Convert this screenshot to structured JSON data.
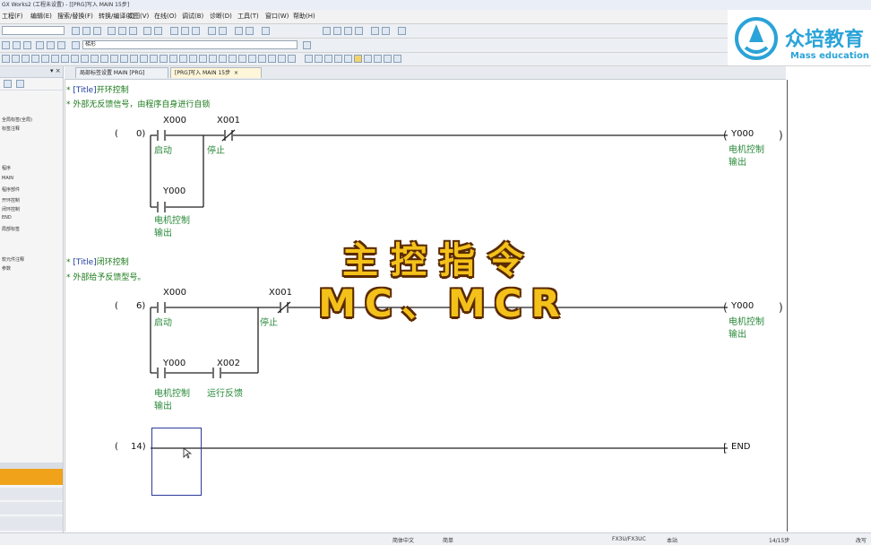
{
  "window": {
    "title": "GX Works2 (工程未设置) - [[PRG]写入 MAIN 15步]"
  },
  "menu": [
    "工程(F)",
    "编辑(E)",
    "搜索/替换(F)",
    "转换/编译(C)",
    "视图(V)",
    "在线(O)",
    "调试(B)",
    "诊断(D)",
    "工具(T)",
    "窗口(W)",
    "帮助(H)"
  ],
  "toolbar": {
    "combo1": "",
    "combo2": "梯形"
  },
  "tabs": [
    {
      "label": "局部标签设置 MAIN [PRG]",
      "active": false
    },
    {
      "label": "[PRG]写入 MAIN 15步",
      "active": true
    }
  ],
  "left_panel": {
    "items": [
      "全局标签(全局)",
      "标签注释",
      "程序",
      "MAIN",
      "程序部件",
      "开环控制",
      "闭环控制",
      "END",
      "局部标签",
      "软元件注释",
      "参数"
    ]
  },
  "ladder": {
    "comments": [
      {
        "tag": "[Title]",
        "text": "开环控制"
      },
      {
        "text": "外部无反馈信号，由程序自身进行自锁"
      },
      {
        "tag": "[Title]",
        "text": "闭环控制"
      },
      {
        "text": "外部给予反馈型号。"
      }
    ],
    "rungs": [
      {
        "step": "0)",
        "contacts": [
          {
            "device": "X000",
            "label": "启动"
          },
          {
            "device": "X001",
            "label": "停止"
          },
          {
            "device": "Y000",
            "label1": "电机控制",
            "label2": "输出"
          }
        ],
        "coil": {
          "device": "Y000",
          "label1": "电机控制",
          "label2": "输出"
        }
      },
      {
        "step": "6)",
        "contacts": [
          {
            "device": "X000",
            "label": "启动"
          },
          {
            "device": "X001",
            "label": "停止"
          },
          {
            "device": "Y000",
            "label1": "电机控制",
            "label2": "输出"
          },
          {
            "device": "X002",
            "label": "运行反馈"
          }
        ],
        "coil": {
          "device": "Y000",
          "label1": "电机控制",
          "label2": "输出"
        }
      },
      {
        "step": "14)",
        "end": "END"
      }
    ],
    "open_paren": "("
  },
  "overlay": {
    "title": "主控指令",
    "subtitle": "MC、MCR"
  },
  "brand": {
    "name_cn": "众培教育",
    "name_en": "Mass education"
  },
  "statusbar": {
    "lang": "简体中文",
    "mode": "简单",
    "plc": "FX3U/FX3UC",
    "station": "本站",
    "steps": "14/15步",
    "ovr": "改写"
  },
  "colors": {
    "comment": "#1a7a1a",
    "label": "#2a8a3a",
    "overlay_text": "#f3c11a",
    "brand": "#2aa3d8"
  }
}
